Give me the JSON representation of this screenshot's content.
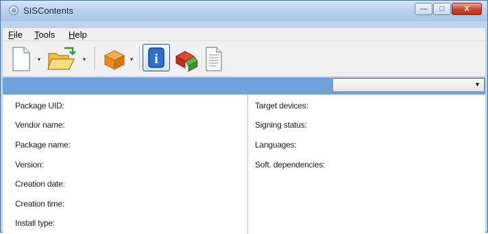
{
  "window": {
    "title": "SISContents",
    "app_icon_glyph": "⊕"
  },
  "window_controls": {
    "minimize_glyph": "—",
    "maximize_glyph": "□",
    "close_glyph": "X"
  },
  "menu": {
    "items": [
      {
        "label_u": "F",
        "label_rest": "ile"
      },
      {
        "label_u": "T",
        "label_rest": "ools"
      },
      {
        "label_u": "H",
        "label_rest": "elp"
      }
    ]
  },
  "toolbar": {
    "icons": [
      "new-document-icon",
      "open-folder-icon",
      "package-icon",
      "info-icon",
      "certificate-icon",
      "text-document-icon"
    ],
    "dropdown_arrow": "▾",
    "info_glyph": "i"
  },
  "filter": {
    "selected_value": "",
    "arrow": "▼"
  },
  "details": {
    "left": [
      "Package UID:",
      "Vendor name:",
      "Package name:",
      "Version:",
      "Creation date:",
      "Creation time:",
      "Install type:"
    ],
    "right": [
      "Target devices:",
      "Signing status:",
      "Languages:",
      "Soft. dependencies:"
    ]
  },
  "colors": {
    "accent_bar": "#6fa1dc",
    "close_button": "#c8452c"
  }
}
